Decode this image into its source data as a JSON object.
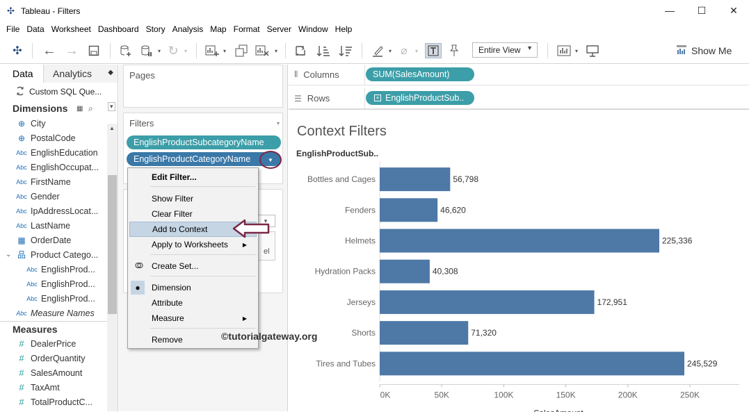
{
  "window": {
    "title": "Tableau - Filters",
    "minimize": "—",
    "maximize": "☐",
    "close": "✕"
  },
  "menu": [
    "File",
    "Data",
    "Worksheet",
    "Dashboard",
    "Story",
    "Analysis",
    "Map",
    "Format",
    "Server",
    "Window",
    "Help"
  ],
  "toolbar": {
    "fit": "Entire View",
    "show_me": "Show Me"
  },
  "data_pane": {
    "tab_data": "Data",
    "tab_analytics": "Analytics",
    "datasource": "Custom SQL Que...",
    "dimensions_label": "Dimensions",
    "dimensions": [
      {
        "type": "geo",
        "name": "City"
      },
      {
        "type": "geo",
        "name": "PostalCode"
      },
      {
        "type": "abc",
        "name": "EnglishEducation"
      },
      {
        "type": "abc",
        "name": "EnglishOccupat..."
      },
      {
        "type": "abc",
        "name": "FirstName"
      },
      {
        "type": "abc",
        "name": "Gender"
      },
      {
        "type": "abc",
        "name": "IpAddressLocat..."
      },
      {
        "type": "abc",
        "name": "LastName"
      },
      {
        "type": "date",
        "name": "OrderDate"
      },
      {
        "type": "hier",
        "name": "Product Catego..."
      },
      {
        "type": "abc-child",
        "name": "EnglishProd..."
      },
      {
        "type": "abc-child",
        "name": "EnglishProd..."
      },
      {
        "type": "abc-child",
        "name": "EnglishProd..."
      },
      {
        "type": "abc-italic",
        "name": "Measure Names"
      }
    ],
    "measures_label": "Measures",
    "measures": [
      "DealerPrice",
      "OrderQuantity",
      "SalesAmount",
      "TaxAmt",
      "TotalProductC..."
    ]
  },
  "shelves": {
    "pages_label": "Pages",
    "filters_label": "Filters",
    "filter_pills": [
      "EnglishProductSubcategoryName",
      "EnglishProductCategoryName"
    ],
    "marks_partial": "el",
    "columns_label": "Columns",
    "columns_pill": "SUM(SalesAmount)",
    "rows_label": "Rows",
    "rows_pill": "EnglishProductSub.."
  },
  "context_menu": {
    "edit_filter": "Edit Filter...",
    "show_filter": "Show Filter",
    "clear_filter": "Clear Filter",
    "add_to_context": "Add to Context",
    "apply_to_worksheets": "Apply to Worksheets",
    "create_set": "Create Set...",
    "dimension": "Dimension",
    "attribute": "Attribute",
    "measure": "Measure",
    "remove": "Remove"
  },
  "watermark": "©tutorialgateway.org",
  "colors": {
    "bar": "#4e79a7",
    "pill": "#3c9ea8",
    "highlight": "#c5d5e4",
    "annotation": "#7a2846"
  },
  "chart_data": {
    "type": "bar",
    "orientation": "horizontal",
    "title": "Context Filters",
    "row_header": "EnglishProductSub..",
    "xlabel": "SalesAmount",
    "categories": [
      "Bottles and Cages",
      "Fenders",
      "Helmets",
      "Hydration Packs",
      "Jerseys",
      "Shorts",
      "Tires and Tubes"
    ],
    "values": [
      56798,
      46620,
      225336,
      40308,
      172951,
      71320,
      245529
    ],
    "value_labels": [
      "56,798",
      "46,620",
      "225,336",
      "40,308",
      "172,951",
      "71,320",
      "245,529"
    ],
    "ticks": [
      0,
      50000,
      100000,
      150000,
      200000,
      250000
    ],
    "tick_labels": [
      "0K",
      "50K",
      "100K",
      "150K",
      "200K",
      "250K"
    ],
    "xlim": [
      0,
      250000
    ]
  }
}
